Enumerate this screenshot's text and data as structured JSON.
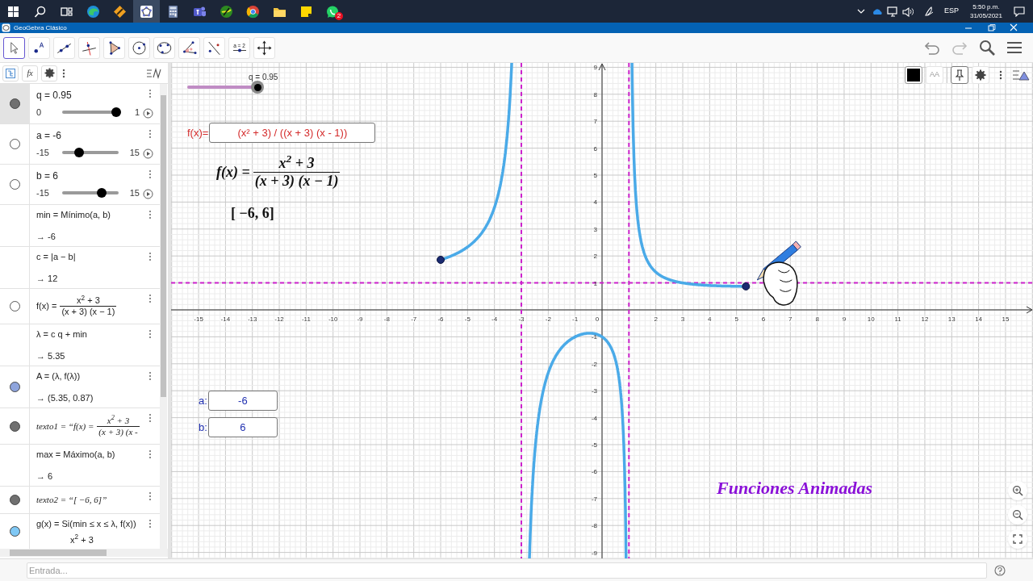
{
  "taskbar": {
    "apps": [
      {
        "kind": "start",
        "selected": false
      },
      {
        "kind": "search",
        "selected": false
      },
      {
        "kind": "task-view",
        "selected": false
      },
      {
        "kind": "browser",
        "selected": false
      },
      {
        "kind": "tool",
        "selected": false
      },
      {
        "kind": "geometry",
        "selected": true
      },
      {
        "kind": "calculator",
        "selected": false
      },
      {
        "kind": "team",
        "selected": false
      },
      {
        "kind": "globe",
        "selected": false
      },
      {
        "kind": "web",
        "selected": false
      },
      {
        "kind": "folder",
        "selected": false
      },
      {
        "kind": "note",
        "selected": false
      },
      {
        "kind": "chat",
        "selected": false,
        "badge": "2"
      }
    ],
    "tray": {
      "language": "ESP",
      "time": "5:50 p.m.",
      "date": "31/05/2021"
    }
  },
  "window": {
    "title": "GeoGebra Clásico"
  },
  "toolbar": {
    "tools": [
      {
        "kind": "move",
        "selected": true
      },
      {
        "kind": "point",
        "selected": false
      },
      {
        "kind": "line",
        "selected": false
      },
      {
        "kind": "perpendicular",
        "selected": false
      },
      {
        "kind": "polygon",
        "selected": false
      },
      {
        "kind": "circle",
        "selected": false
      },
      {
        "kind": "conic",
        "selected": false
      },
      {
        "kind": "angle",
        "selected": false
      },
      {
        "kind": "reflect",
        "selected": false
      },
      {
        "kind": "slider",
        "selected": false,
        "label": "a = 2"
      },
      {
        "kind": "pan",
        "selected": false
      }
    ]
  },
  "algebra_view": {
    "header_label": "fx",
    "items": [
      {
        "kind": "slider",
        "selected": true,
        "visible": true,
        "color": "#707070",
        "label": "q = 0.95",
        "min": "0",
        "max": "1",
        "level": 0.95
      },
      {
        "kind": "slider",
        "selected": false,
        "visible": false,
        "label": "a = -6",
        "min": "-15",
        "max": "15",
        "level": 0.3
      },
      {
        "kind": "slider",
        "selected": false,
        "visible": false,
        "label": "b = 6",
        "min": "-15",
        "max": "15",
        "level": 0.7
      },
      {
        "kind": "expression",
        "selected": false,
        "definition": "min = Mínimo(a, b)",
        "value": "→ -6"
      },
      {
        "kind": "expression",
        "selected": false,
        "definition": "c = |a − b|",
        "value": "→ 12"
      },
      {
        "kind": "fraction",
        "selected": false,
        "visible": false,
        "lhs": "f(x) =",
        "numerator": "x$^{2}$ + 3",
        "denominator": "(x + 3) (x − 1)"
      },
      {
        "kind": "expression",
        "selected": false,
        "definition": "λ = c q + min",
        "value": "→ 5.35"
      },
      {
        "kind": "expression",
        "selected": false,
        "visible": true,
        "color": "#8ea4dc",
        "definition": "A = (λ, f(λ))",
        "value": "→ (5.35, 0.87)"
      },
      {
        "kind": "text_fraction",
        "selected": false,
        "visible": true,
        "color": "#707070",
        "lhs": "texto1 = “f(x) =",
        "numerator": "x$^{2}$ + 3",
        "denominator": "(x + 3) (x -"
      },
      {
        "kind": "expression",
        "selected": false,
        "definition": "max = Máximo(a, b)",
        "value": "→ 6"
      },
      {
        "kind": "text",
        "selected": false,
        "visible": true,
        "color": "#707070",
        "definition": "texto2 = “[ −6, 6]”"
      },
      {
        "kind": "partial",
        "selected": false,
        "visible": true,
        "color": "#7fc8f5",
        "definition": "g(x) = Si(min ≤ x ≤ λ, f(x))",
        "value": "x$^{2}$ + 3"
      }
    ]
  },
  "graphics_view": {
    "slider": {
      "label": "q = 0.95",
      "level": 0.95
    },
    "input_boxes": [
      {
        "label": "f(x)=",
        "value": "(x² + 3) / ((x + 3) (x - 1))",
        "color": "#d42a2a"
      },
      {
        "label": "a:",
        "value": "-6",
        "color": "#1f2fb0"
      },
      {
        "label": "b:",
        "value": "6",
        "color": "#1f2fb0"
      }
    ],
    "formula": {
      "lhs": "f(x) =",
      "numerator": "x$^{2}$ + 3",
      "denominator": "(x + 3) (x − 1)"
    },
    "interval": "[ −6, 6]",
    "title": "Funciones Animadas",
    "x_axis_labels": [
      "-15",
      "-14",
      "-13",
      "-12",
      "-11",
      "-10",
      "-9",
      "-8",
      "-7",
      "-6",
      "-5",
      "-4",
      "-3",
      "-2",
      "-1",
      "0",
      "2",
      "3",
      "4",
      "5",
      "6",
      "7",
      "8",
      "9",
      "10",
      "11",
      "12",
      "13",
      "14",
      "15"
    ],
    "y_axis_labels": [
      "9",
      "8",
      "7",
      "6",
      "5",
      "4",
      "3",
      "2",
      "1",
      "-1",
      "-2",
      "-3",
      "-4",
      "-5",
      "-6",
      "-7",
      "-8",
      "-9"
    ],
    "style_bar": {
      "text_style": "AA"
    }
  },
  "input_bar": {
    "placeholder": "Entrada..."
  }
}
